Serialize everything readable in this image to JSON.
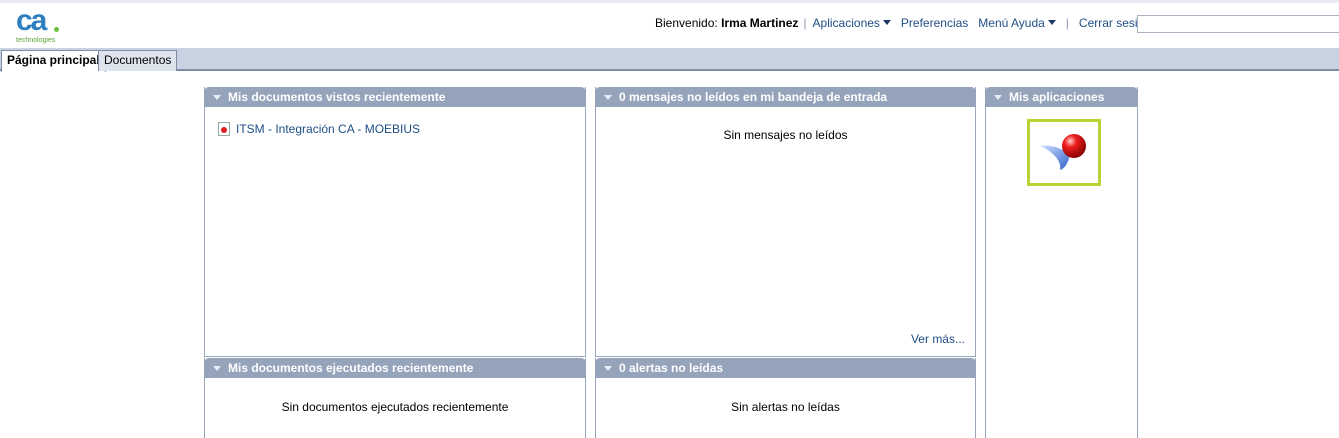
{
  "header": {
    "logo_text": "ca",
    "logo_subtext": "technologies",
    "welcome_prefix": "Bienvenido:",
    "user_name": "Irma Martinez",
    "nav": {
      "applications": "Aplicaciones",
      "preferences": "Preferencias",
      "help_menu": "Menú Ayuda",
      "logout": "Cerrar sesión"
    },
    "search_value": ""
  },
  "tabs": [
    {
      "label": "Página principal",
      "active": true
    },
    {
      "label": "Documentos",
      "active": false
    }
  ],
  "portlets": {
    "recent_viewed": {
      "title": "Mis documentos vistos recientemente",
      "items": [
        "ITSM - Integración CA - MOEBIUS"
      ]
    },
    "unread_messages": {
      "title": "0 mensajes no leídos en mi bandeja de entrada",
      "empty_text": "Sin mensajes no leídos",
      "more_link": "Ver más..."
    },
    "my_apps": {
      "title": "Mis aplicaciones",
      "app_icon": "red-pushpin-icon"
    },
    "recent_executed": {
      "title": "Mis documentos ejecutados recientemente",
      "empty_text": "Sin documentos ejecutados recientemente"
    },
    "unread_alerts": {
      "title": "0 alertas no leídas",
      "empty_text": "Sin alertas no leídas"
    }
  },
  "colors": {
    "portlet_header": "#95a3bb",
    "link": "#1f4e86",
    "app_tile_border": "#b7d334",
    "logo_blue": "#2e7fc0",
    "logo_green": "#5da336"
  }
}
